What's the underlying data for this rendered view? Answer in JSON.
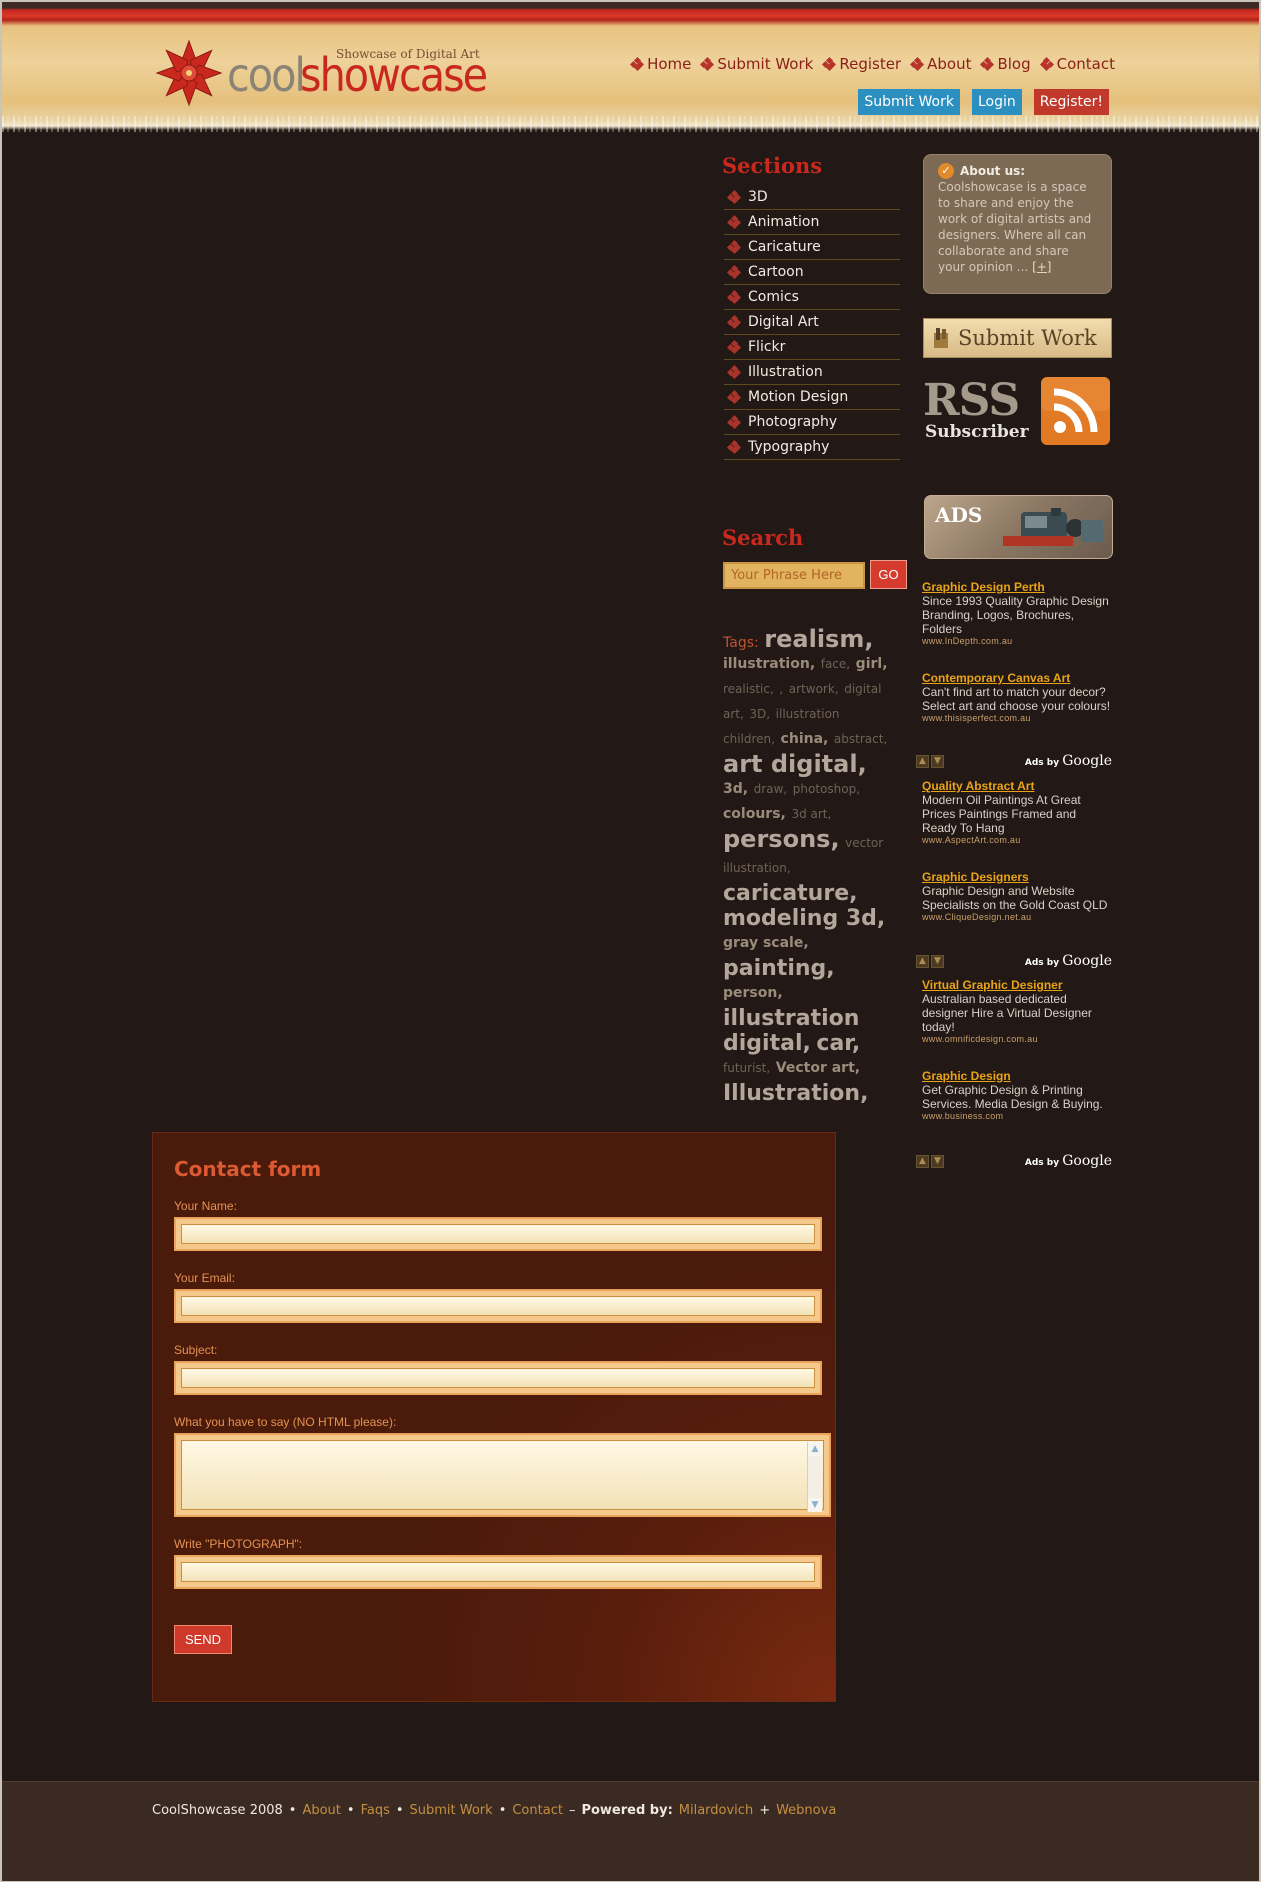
{
  "header": {
    "logo_tagline": "Showcase of Digital Art",
    "logo_word_1": "cool",
    "logo_word_2": "showcase",
    "nav": [
      "Home",
      "Submit Work",
      "Register",
      "About",
      "Blog",
      "Contact"
    ],
    "auth_buttons": {
      "submit": "Submit Work",
      "login": "Login",
      "register": "Register!"
    }
  },
  "sections": {
    "title": "Sections",
    "items": [
      "3D",
      "Animation",
      "Caricature",
      "Cartoon",
      "Comics",
      "Digital Art",
      "Flickr",
      "Illustration",
      "Motion Design",
      "Photography",
      "Typography"
    ]
  },
  "search": {
    "title": "Search",
    "placeholder": "Your Phrase Here",
    "button": "GO"
  },
  "tags": {
    "label": "Tags:",
    "items": [
      {
        "text": "realism,",
        "size": "xl"
      },
      {
        "text": "illustration,",
        "size": "m"
      },
      {
        "text": "face,",
        "size": "s"
      },
      {
        "text": "girl,",
        "size": "m"
      },
      {
        "text": "realistic,",
        "size": "s"
      },
      {
        "text": ",",
        "size": "s"
      },
      {
        "text": "artwork,",
        "size": "s"
      },
      {
        "text": "digital art,",
        "size": "s"
      },
      {
        "text": "3D,",
        "size": "s"
      },
      {
        "text": "illustration children,",
        "size": "s"
      },
      {
        "text": "china,",
        "size": "m"
      },
      {
        "text": "abstract,",
        "size": "s"
      },
      {
        "text": "art digital,",
        "size": "xl"
      },
      {
        "text": "3d,",
        "size": "m"
      },
      {
        "text": "draw,",
        "size": "s"
      },
      {
        "text": "photoshop,",
        "size": "s"
      },
      {
        "text": "colours,",
        "size": "m"
      },
      {
        "text": "3d art,",
        "size": "s"
      },
      {
        "text": "persons,",
        "size": "xl"
      },
      {
        "text": "vector illustration,",
        "size": "s"
      },
      {
        "text": "caricature,",
        "size": "l"
      },
      {
        "text": "modeling 3d,",
        "size": "l"
      },
      {
        "text": "gray scale,",
        "size": "m"
      },
      {
        "text": "painting,",
        "size": "l"
      },
      {
        "text": "person,",
        "size": "m"
      },
      {
        "text": "illustration digital,",
        "size": "l"
      },
      {
        "text": "car,",
        "size": "l"
      },
      {
        "text": "futurist,",
        "size": "s"
      },
      {
        "text": "Vector art,",
        "size": "m"
      },
      {
        "text": "Illustration,",
        "size": "l"
      }
    ]
  },
  "about": {
    "title": "About us:",
    "text": "Coolshowcase is a space to share and enjoy the work of digital artists and designers. Where all can collaborate and share your opinion ...",
    "more": "[+]"
  },
  "banners": {
    "submit_work": "Submit Work",
    "rss": "RSS",
    "rss_sub": "Subscriber",
    "ads": "ADS"
  },
  "ads": [
    {
      "title": "Graphic Design Perth",
      "desc": "Since 1993 Quality Graphic Design Branding, Logos, Brochures, Folders",
      "url": "www.InDepth.com.au"
    },
    {
      "title": "Contemporary Canvas Art",
      "desc": "Can't find art to match your decor? Select art and choose your colours!",
      "url": "www.thisisperfect.com.au"
    },
    {
      "title": "Quality Abstract Art",
      "desc": "Modern Oil Paintings At Great Prices Paintings Framed and Ready To Hang",
      "url": "www.AspectArt.com.au"
    },
    {
      "title": "Graphic Designers",
      "desc": "Graphic Design and Website Specialists on the Gold Coast QLD",
      "url": "www.CliqueDesign.net.au"
    },
    {
      "title": "Virtual Graphic Designer",
      "desc": "Australian based dedicated designer Hire a Virtual Designer today!",
      "url": "www.omnificdesign.com.au"
    },
    {
      "title": "Graphic Design",
      "desc": "Get Graphic Design & Printing Services. Media Design & Buying.",
      "url": "www.business.com"
    }
  ],
  "ads_by": {
    "prefix": "Ads by",
    "brand": "Google"
  },
  "contact": {
    "title": "Contact form",
    "name_label": "Your Name:",
    "email_label": "Your Email:",
    "subject_label": "Subject:",
    "message_label": "What you have to say (NO HTML please):",
    "captcha_label": "Write \"PHOTOGRAPH\":",
    "send": "SEND"
  },
  "footer": {
    "copyright": "CoolShowcase 2008",
    "links": [
      "About",
      "Faqs",
      "Submit Work",
      "Contact"
    ],
    "powered_by": "Powered by:",
    "credit_1": "Milardovich",
    "credit_2": "Webnova"
  },
  "colors": {
    "accent_red": "#c9281f",
    "background": "#221815",
    "gold_link": "#e8a318"
  }
}
